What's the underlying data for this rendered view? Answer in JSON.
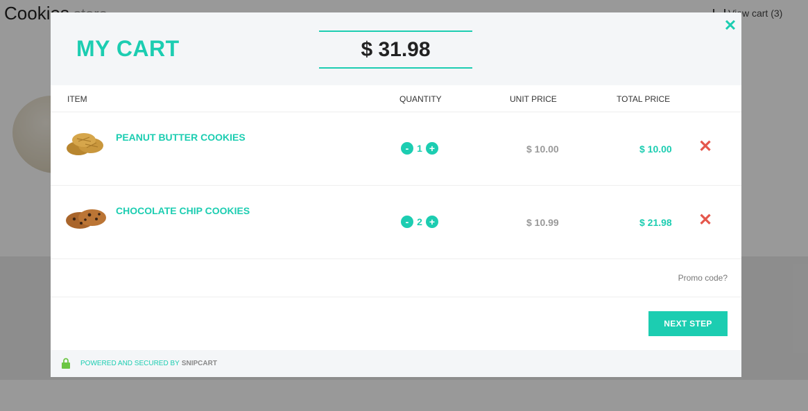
{
  "background": {
    "brand_name": "Cookies",
    "brand_sub": "store",
    "view_cart_label": "View cart (3)"
  },
  "cart": {
    "title": "MY CART",
    "total": "$ 31.98",
    "close_icon": "close-icon"
  },
  "columns": {
    "item": "ITEM",
    "quantity": "QUANTITY",
    "unit_price": "UNIT PRICE",
    "total_price": "TOTAL PRICE"
  },
  "items": [
    {
      "name": "PEANUT BUTTER COOKIES",
      "quantity": "1",
      "unit_price": "$ 10.00",
      "total_price": "$ 10.00"
    },
    {
      "name": "CHOCOLATE CHIP COOKIES",
      "quantity": "2",
      "unit_price": "$ 10.99",
      "total_price": "$ 21.98"
    }
  ],
  "controls": {
    "decrement": "-",
    "increment": "+",
    "remove": "✕"
  },
  "promo": {
    "label": "Promo code?"
  },
  "next_step": {
    "label": "NEXT STEP"
  },
  "footer": {
    "powered_text": "POWERED AND SECURED BY",
    "brand": "SNIPCART"
  },
  "colors": {
    "accent": "#1ccdb1",
    "remove": "#e5574c",
    "header_bg": "#f4f6f8",
    "lock": "#6cc644"
  }
}
